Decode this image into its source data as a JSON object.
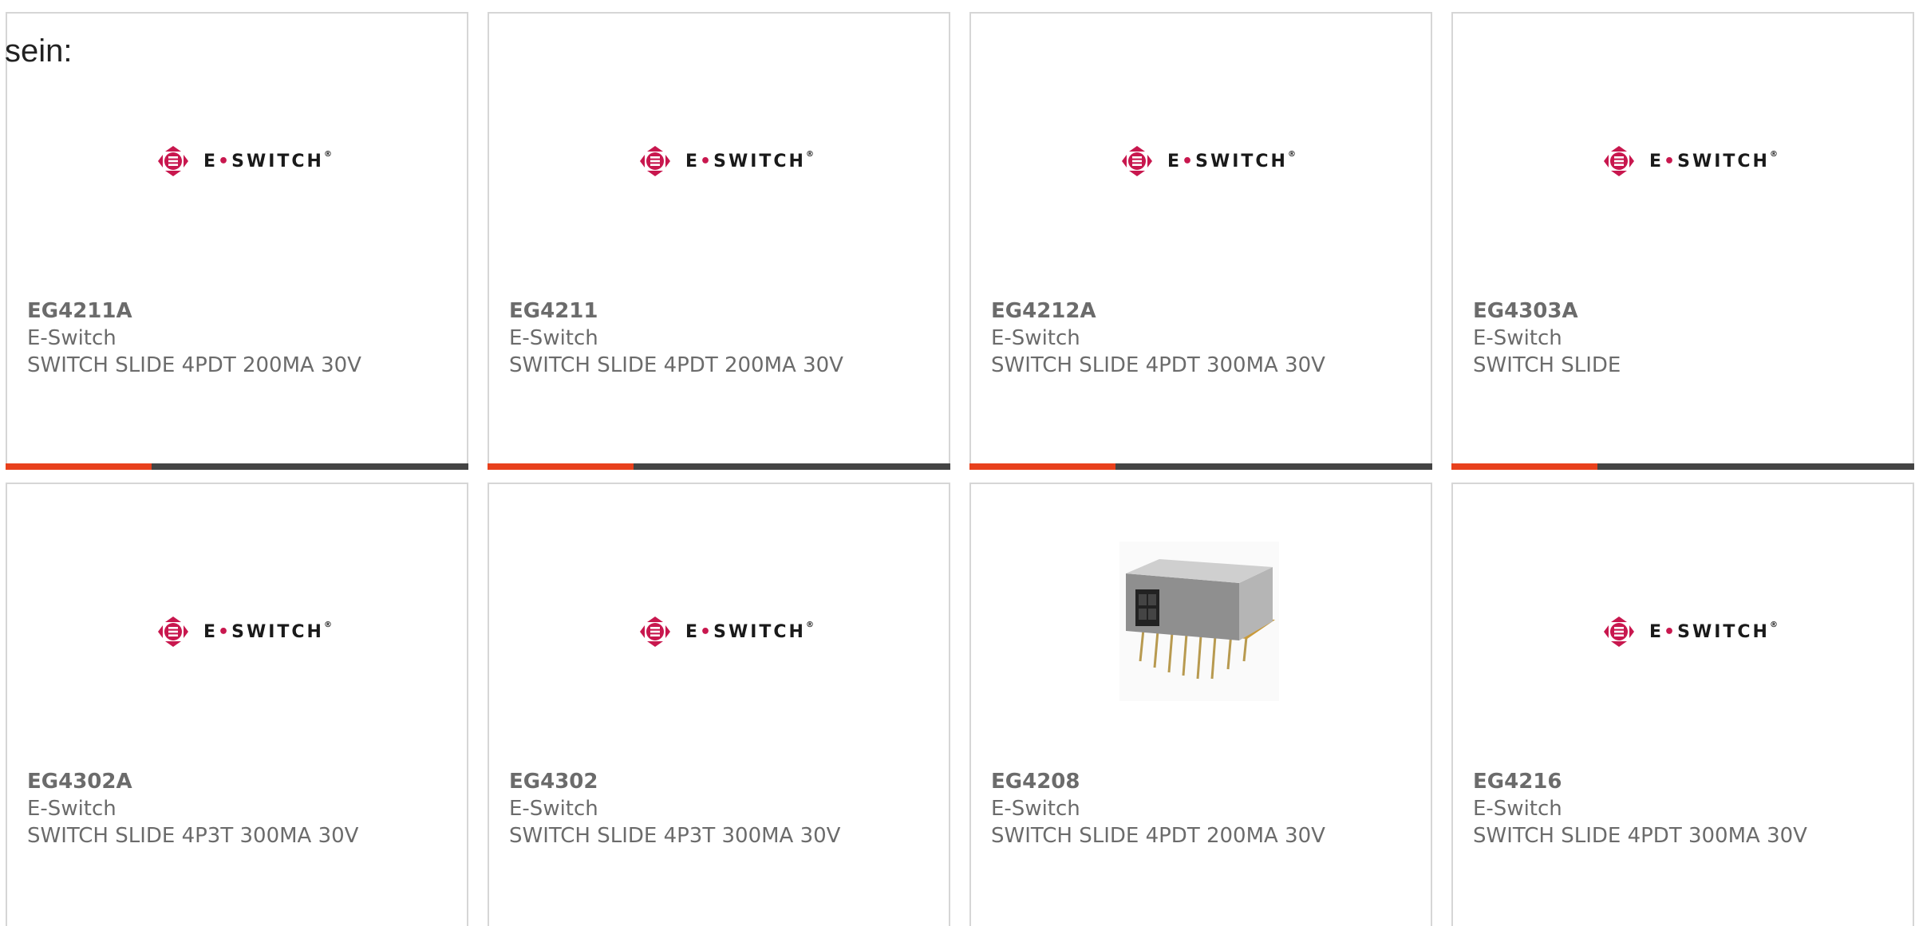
{
  "intro_text": "sein:",
  "brand": {
    "logo_text_left": "E",
    "logo_text_right": "SWITCH",
    "logo_reg": "®",
    "accent_color": "#e8401c",
    "logo_color": "#c8174e",
    "bar_color": "#444444"
  },
  "products": [
    {
      "part": "EG4211A",
      "manufacturer": "E-Switch",
      "description": "SWITCH SLIDE 4PDT 200MA 30V",
      "image": "e-switch-logo"
    },
    {
      "part": "EG4211",
      "manufacturer": "E-Switch",
      "description": "SWITCH SLIDE 4PDT 200MA 30V",
      "image": "e-switch-logo"
    },
    {
      "part": "EG4212A",
      "manufacturer": "E-Switch",
      "description": "SWITCH SLIDE 4PDT 300MA 30V",
      "image": "e-switch-logo"
    },
    {
      "part": "EG4303A",
      "manufacturer": "E-Switch",
      "description": "SWITCH SLIDE",
      "image": "e-switch-logo"
    },
    {
      "part": "EG4302A",
      "manufacturer": "E-Switch",
      "description": "SWITCH SLIDE 4P3T 300MA 30V",
      "image": "e-switch-logo"
    },
    {
      "part": "EG4302",
      "manufacturer": "E-Switch",
      "description": "SWITCH SLIDE 4P3T 300MA 30V",
      "image": "e-switch-logo"
    },
    {
      "part": "EG4208",
      "manufacturer": "E-Switch",
      "description": "SWITCH SLIDE 4PDT 200MA 30V",
      "image": "slide-switch-photo"
    },
    {
      "part": "EG4216",
      "manufacturer": "E-Switch",
      "description": "SWITCH SLIDE 4PDT 300MA 30V",
      "image": "e-switch-logo"
    }
  ]
}
